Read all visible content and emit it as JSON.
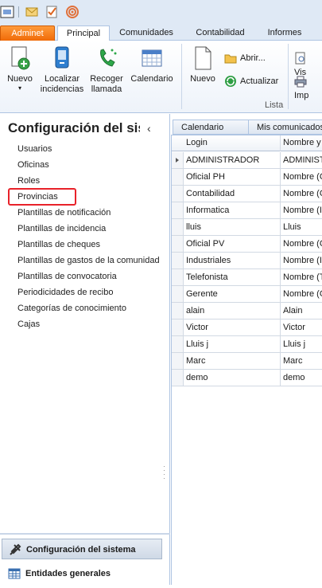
{
  "ribbon_tabs": {
    "app": "Adminet",
    "principal": "Principal",
    "comunidades": "Comunidades",
    "contabilidad": "Contabilidad",
    "informes": "Informes"
  },
  "ribbon": {
    "nuevo": "Nuevo",
    "localizar_1": "Localizar",
    "localizar_2": "incidencias",
    "recoger_1": "Recoger",
    "recoger_2": "llamada",
    "calendario": "Calendario",
    "nuevo2": "Nuevo",
    "abrir": "Abrir...",
    "actualizar": "Actualizar",
    "vista": "Vis",
    "imprimir": "Imp",
    "group_lista": "Lista"
  },
  "nav": {
    "title": "Configuración del sistema",
    "items": [
      "Usuarios",
      "Oficinas",
      "Roles",
      "Provincias",
      "Plantillas de notificación",
      "Plantillas de incidencia",
      "Plantillas de cheques",
      "Plantillas de gastos de la comunidad",
      "Plantillas de convocatoria",
      "Periodicidades de recibo",
      "Categorías de conocimiento",
      "Cajas"
    ],
    "bottom_active": "Configuración del sistema",
    "bottom_second": "Entidades generales"
  },
  "content_tabs": {
    "calendario": "Calendario",
    "comunicados": "Mis comunicados a"
  },
  "grid": {
    "columns": [
      "Login",
      "Nombre y"
    ],
    "rows": [
      [
        "ADMINISTRADOR",
        "ADMINIST"
      ],
      [
        "Oficial PH",
        "Nombre (C"
      ],
      [
        "Contabilidad",
        "Nombre (C"
      ],
      [
        "Informatica",
        "Nombre (In"
      ],
      [
        "lluis",
        "Lluis"
      ],
      [
        "Oficial PV",
        "Nombre (C"
      ],
      [
        "Industriales",
        "Nombre (In"
      ],
      [
        "Telefonista",
        "Nombre (T"
      ],
      [
        "Gerente",
        "Nombre (G"
      ],
      [
        "alain",
        "Alain"
      ],
      [
        "Victor",
        "Victor"
      ],
      [
        "Lluis j",
        "Lluis j"
      ],
      [
        "Marc",
        "Marc"
      ],
      [
        "demo",
        "demo"
      ]
    ]
  }
}
